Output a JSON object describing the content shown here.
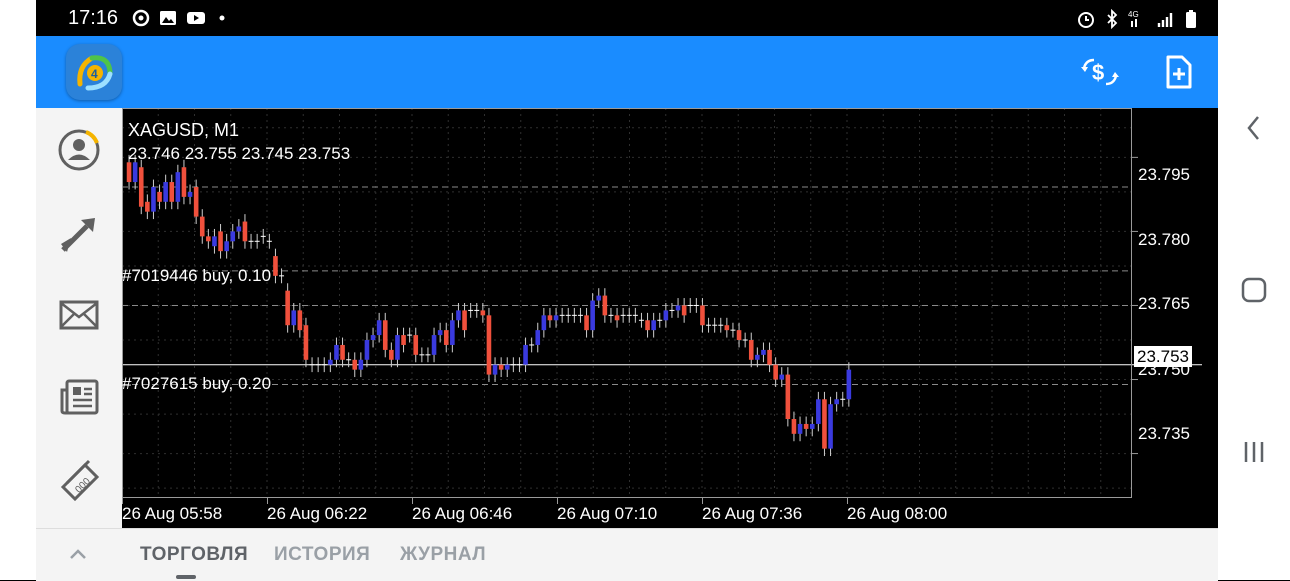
{
  "status_bar": {
    "time": "17:16",
    "left_icons": [
      "sync-icon",
      "gallery-icon",
      "youtube-icon",
      "dot-icon"
    ],
    "right_icons": [
      "alarm-icon",
      "bluetooth-icon",
      "4g-signal-icon",
      "signal-icon",
      "battery-icon"
    ]
  },
  "toolbar": {
    "logo_icon": "metatrader-logo-icon",
    "trade_icon": "currency-exchange-icon",
    "new_order_icon": "new-document-icon"
  },
  "sidebar": {
    "items": [
      {
        "icon": "account-icon"
      },
      {
        "icon": "trade-arrows-icon"
      },
      {
        "icon": "mail-icon"
      },
      {
        "icon": "news-icon"
      },
      {
        "icon": "calendar-icon"
      }
    ]
  },
  "chart": {
    "symbol": "XAGUSD, M1",
    "ohlc": "23.746 23.755 23.745 23.753",
    "bid": "23.753",
    "orders": [
      "#7019446 buy, 0.10",
      "#7027615 buy, 0.20"
    ],
    "price_ticks": [
      "23.795",
      "23.780",
      "23.765",
      "23.750",
      "23.735"
    ],
    "time_ticks": [
      "26 Aug 05:58",
      "26 Aug 06:22",
      "26 Aug 06:46",
      "26 Aug 07:10",
      "26 Aug 07:36",
      "26 Aug 08:00"
    ],
    "colors": {
      "bull": "#3a3adf",
      "bear": "#f0503c",
      "grid": "#2f2f2f",
      "text": "#ffffff"
    }
  },
  "chart_data": {
    "type": "candlestick",
    "title": "XAGUSD, M1",
    "ylim": [
      23.726,
      23.805
    ],
    "yticks": [
      23.795,
      23.78,
      23.765,
      23.75,
      23.735
    ],
    "xticks": [
      "26 Aug 05:58",
      "26 Aug 06:22",
      "26 Aug 06:46",
      "26 Aug 07:10",
      "26 Aug 07:36",
      "26 Aug 08:00"
    ],
    "order_levels": [
      23.789,
      23.765,
      23.772,
      23.749
    ],
    "bid": 23.753,
    "candles": [
      [
        23.794,
        23.79
      ],
      [
        23.79,
        23.794
      ],
      [
        23.793,
        23.785
      ],
      [
        23.786,
        23.784
      ],
      [
        23.784,
        23.789
      ],
      [
        23.788,
        23.786
      ],
      [
        23.786,
        23.79
      ],
      [
        23.79,
        23.786
      ],
      [
        23.786,
        23.792
      ],
      [
        23.793,
        23.787
      ],
      [
        23.787,
        23.788
      ],
      [
        23.789,
        23.783
      ],
      [
        23.783,
        23.779
      ],
      [
        23.779,
        23.778
      ],
      [
        23.777,
        23.779
      ],
      [
        23.78,
        23.776
      ],
      [
        23.776,
        23.778
      ],
      [
        23.778,
        23.78
      ],
      [
        23.78,
        23.781
      ],
      [
        23.782,
        23.778
      ],
      [
        23.778,
        23.778
      ],
      [
        23.778,
        23.778
      ],
      [
        23.779,
        23.779
      ],
      [
        23.778,
        23.778
      ],
      [
        23.775,
        23.771
      ],
      [
        23.771,
        23.771
      ],
      [
        23.768,
        23.761
      ],
      [
        23.761,
        23.764
      ],
      [
        23.764,
        23.76
      ],
      [
        23.761,
        23.754
      ],
      [
        23.753,
        23.753
      ],
      [
        23.753,
        23.753
      ],
      [
        23.753,
        23.753
      ],
      [
        23.753,
        23.754
      ],
      [
        23.754,
        23.757
      ],
      [
        23.757,
        23.754
      ],
      [
        23.754,
        23.754
      ],
      [
        23.754,
        23.752
      ],
      [
        23.752,
        23.754
      ],
      [
        23.754,
        23.758
      ],
      [
        23.758,
        23.759
      ],
      [
        23.759,
        23.762
      ],
      [
        23.762,
        23.756
      ],
      [
        23.756,
        23.754
      ],
      [
        23.754,
        23.759
      ],
      [
        23.759,
        23.757
      ],
      [
        23.759,
        23.759
      ],
      [
        23.759,
        23.755
      ],
      [
        23.755,
        23.755
      ],
      [
        23.755,
        23.755
      ],
      [
        23.755,
        23.759
      ],
      [
        23.759,
        23.76
      ],
      [
        23.76,
        23.757
      ],
      [
        23.757,
        23.762
      ],
      [
        23.762,
        23.764
      ],
      [
        23.764,
        23.76
      ],
      [
        23.764,
        23.764
      ],
      [
        23.764,
        23.764
      ],
      [
        23.764,
        23.763
      ],
      [
        23.763,
        23.751
      ],
      [
        23.751,
        23.753
      ],
      [
        23.753,
        23.752
      ],
      [
        23.752,
        23.753
      ],
      [
        23.753,
        23.753
      ],
      [
        23.753,
        23.753
      ],
      [
        23.753,
        23.757
      ],
      [
        23.757,
        23.757
      ],
      [
        23.757,
        23.76
      ],
      [
        23.76,
        23.763
      ],
      [
        23.763,
        23.762
      ],
      [
        23.762,
        23.763
      ],
      [
        23.763,
        23.763
      ],
      [
        23.763,
        23.763
      ],
      [
        23.763,
        23.763
      ],
      [
        23.763,
        23.763
      ],
      [
        23.763,
        23.76
      ],
      [
        23.76,
        23.766
      ],
      [
        23.766,
        23.767
      ],
      [
        23.767,
        23.763
      ],
      [
        23.763,
        23.763
      ],
      [
        23.763,
        23.762
      ],
      [
        23.763,
        23.763
      ],
      [
        23.763,
        23.763
      ],
      [
        23.763,
        23.763
      ],
      [
        23.762,
        23.762
      ],
      [
        23.762,
        23.76
      ],
      [
        23.76,
        23.762
      ],
      [
        23.762,
        23.762
      ],
      [
        23.762,
        23.764
      ],
      [
        23.764,
        23.764
      ],
      [
        23.764,
        23.765
      ],
      [
        23.765,
        23.763
      ],
      [
        23.765,
        23.765
      ],
      [
        23.765,
        23.765
      ],
      [
        23.765,
        23.761
      ],
      [
        23.761,
        23.761
      ],
      [
        23.761,
        23.761
      ],
      [
        23.761,
        23.761
      ],
      [
        23.761,
        23.76
      ],
      [
        23.76,
        23.76
      ],
      [
        23.76,
        23.758
      ],
      [
        23.758,
        23.758
      ],
      [
        23.758,
        23.754
      ],
      [
        23.754,
        23.755
      ],
      [
        23.755,
        23.756
      ],
      [
        23.756,
        23.753
      ],
      [
        23.753,
        23.75
      ],
      [
        23.75,
        23.751
      ],
      [
        23.751,
        23.742
      ],
      [
        23.742,
        23.739
      ],
      [
        23.739,
        23.741
      ],
      [
        23.741,
        23.74
      ],
      [
        23.74,
        23.741
      ],
      [
        23.741,
        23.746
      ],
      [
        23.746,
        23.736
      ],
      [
        23.736,
        23.745
      ],
      [
        23.745,
        23.746
      ],
      [
        23.746,
        23.746
      ],
      [
        23.746,
        23.752
      ]
    ]
  },
  "bottom_bar": {
    "collapse_icon": "chevron-up-icon",
    "tabs": [
      "ТОРГОВЛЯ",
      "ИСТОРИЯ",
      "ЖУРНАЛ"
    ],
    "active_tab": 0
  },
  "nav_bar": {
    "icons": [
      "back-icon",
      "home-icon",
      "recents-icon"
    ]
  }
}
